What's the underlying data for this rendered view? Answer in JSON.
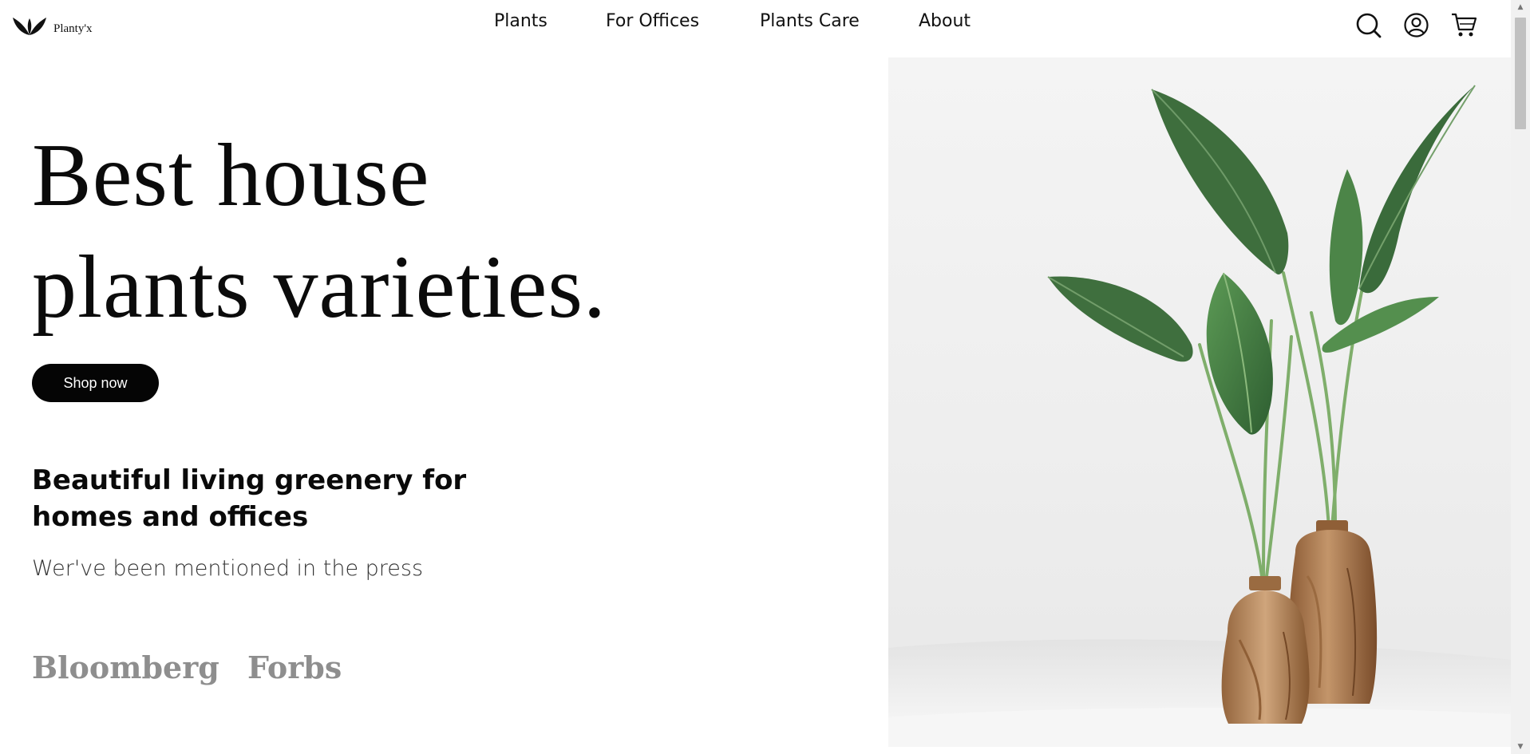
{
  "brand": {
    "name": "Planty'x",
    "icon": "leaf-logo-icon"
  },
  "nav": {
    "items": [
      {
        "label": "Plants"
      },
      {
        "label": "For Offices"
      },
      {
        "label": "Plants Care"
      },
      {
        "label": "About"
      }
    ]
  },
  "header_icons": [
    "search-icon",
    "account-icon",
    "cart-icon"
  ],
  "hero": {
    "title_line1": "Best house",
    "title_line2": "plants varieties.",
    "cta_label": "Shop now",
    "tagline": "Beautiful living greenery for homes and offices",
    "press_text": "Wer've been mentioned in the press",
    "press_logos": [
      "Bloomberg",
      "Forbs"
    ]
  },
  "colors": {
    "text": "#0a0a0a",
    "button_bg": "#050505",
    "button_text": "#ffffff",
    "press_logo": "#8e8e8e",
    "leaf_green": "#3f7a3f",
    "vase_wood": "#a9774a"
  }
}
